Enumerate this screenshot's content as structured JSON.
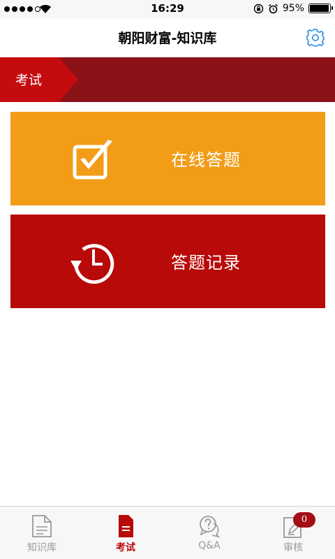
{
  "status_bar": {
    "time": "16:29",
    "battery_text": "95%",
    "battery_level": 0.95,
    "signal_bars_filled": 4,
    "signal_bars_total": 5
  },
  "nav": {
    "title": "朝阳财富-知识库",
    "settings_icon": "gear-icon",
    "accent_color": "#2c8ee6"
  },
  "section": {
    "label": "考试",
    "tab_color": "#c40b0f",
    "bar_color": "#8b1216"
  },
  "cards": [
    {
      "label": "在线答题",
      "icon": "checkbox-icon",
      "color": "#f29c17"
    },
    {
      "label": "答题记录",
      "icon": "clock-history-icon",
      "color": "#b80a08"
    }
  ],
  "tabs": [
    {
      "label": "知识库",
      "icon": "document-icon",
      "active": false
    },
    {
      "label": "考试",
      "icon": "exam-icon",
      "active": true
    },
    {
      "label": "Q&A",
      "icon": "qa-icon",
      "active": false
    },
    {
      "label": "审核",
      "icon": "review-icon",
      "active": false,
      "badge": "0"
    }
  ]
}
